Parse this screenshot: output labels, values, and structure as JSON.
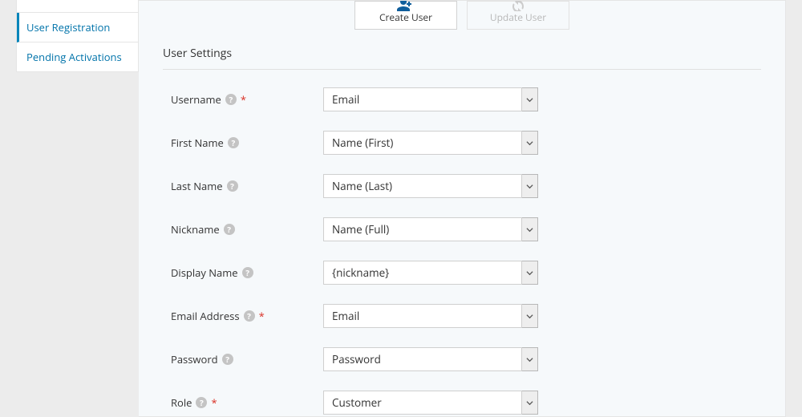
{
  "sidebar": {
    "tabs": [
      {
        "label": "User Registration",
        "active": true
      },
      {
        "label": "Pending Activations",
        "active": false
      }
    ]
  },
  "topButtons": {
    "create": "Create User",
    "update": "Update User"
  },
  "section": {
    "title": "User Settings"
  },
  "fields": [
    {
      "label": "Username",
      "required": true,
      "value": "Email"
    },
    {
      "label": "First Name",
      "required": false,
      "value": "Name (First)"
    },
    {
      "label": "Last Name",
      "required": false,
      "value": "Name (Last)"
    },
    {
      "label": "Nickname",
      "required": false,
      "value": "Name (Full)"
    },
    {
      "label": "Display Name",
      "required": false,
      "value": "{nickname}"
    },
    {
      "label": "Email Address",
      "required": true,
      "value": "Email"
    },
    {
      "label": "Password",
      "required": false,
      "value": "Password"
    },
    {
      "label": "Role",
      "required": true,
      "value": "Customer"
    }
  ]
}
